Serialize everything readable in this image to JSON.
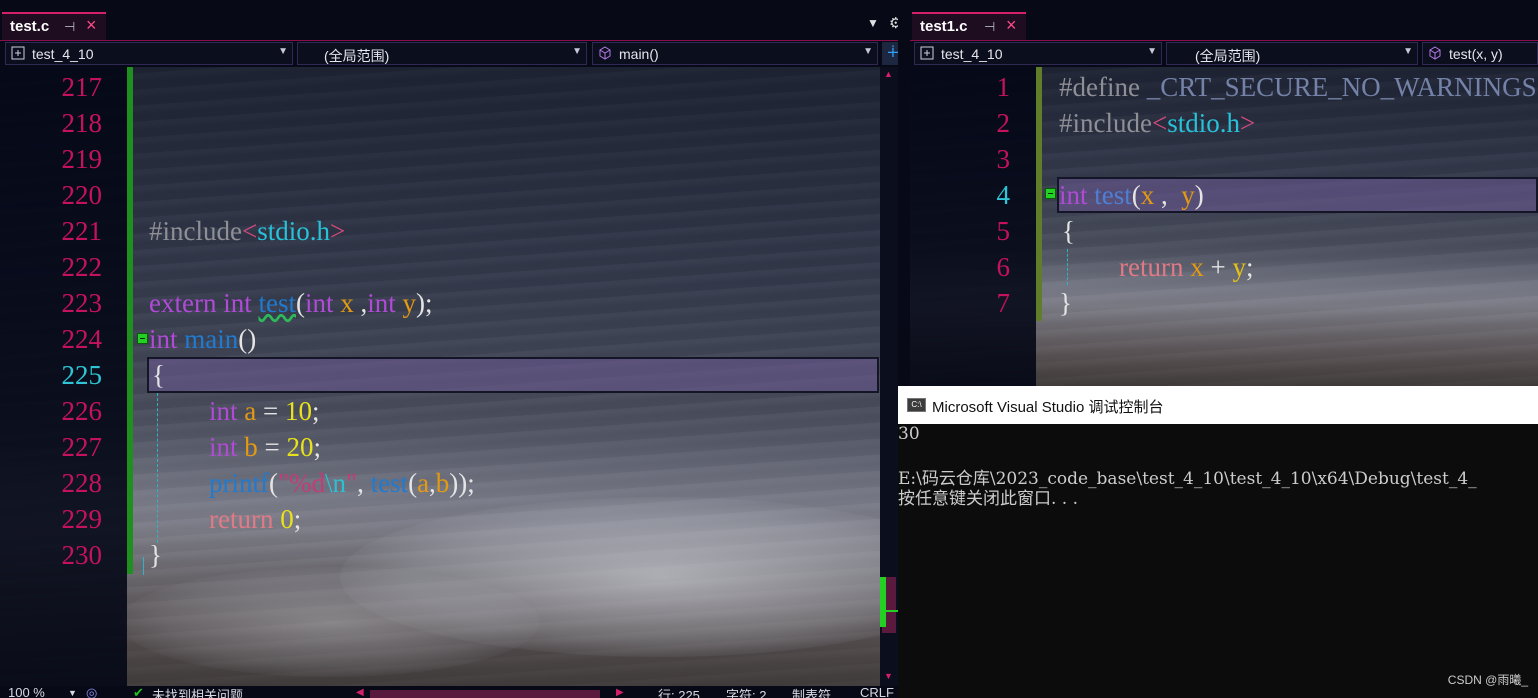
{
  "left_editor": {
    "tab_label": "test.c",
    "project_dropdown": "test_4_10",
    "scope_dropdown": "(全局范围)",
    "function_dropdown": "main()",
    "line_numbers": [
      "217",
      "218",
      "219",
      "220",
      "221",
      "222",
      "223",
      "224",
      "225",
      "226",
      "227",
      "228",
      "229",
      "230"
    ],
    "current_line": "225"
  },
  "right_editor": {
    "tab_label": "test1.c",
    "project_dropdown": "test_4_10",
    "scope_dropdown": "(全局范围)",
    "function_dropdown": "test(x, y)",
    "line_numbers": [
      "1",
      "2",
      "3",
      "4",
      "5",
      "6",
      "7"
    ]
  },
  "console": {
    "title": "Microsoft Visual Studio 调试控制台",
    "output_value": "30",
    "exit_path": "E:\\码云仓库\\2023_code_base\\test_4_10\\test_4_10\\x64\\Debug\\test_4_",
    "prompt": "按任意键关闭此窗口. . ."
  },
  "status_bar": {
    "zoom": "100 %",
    "issues": "未找到相关问题",
    "line": "行: 225",
    "char": "字符: 2",
    "tabs": "制表符",
    "eol": "CRLF"
  },
  "watermark": "CSDN @雨曦_",
  "colors": {
    "keyword": "#b04ad7",
    "function": "#1f7bd1",
    "variable": "#e39a12",
    "number": "#e8e21c",
    "line_number": "#c5125f",
    "accent": "#d41f6a"
  }
}
